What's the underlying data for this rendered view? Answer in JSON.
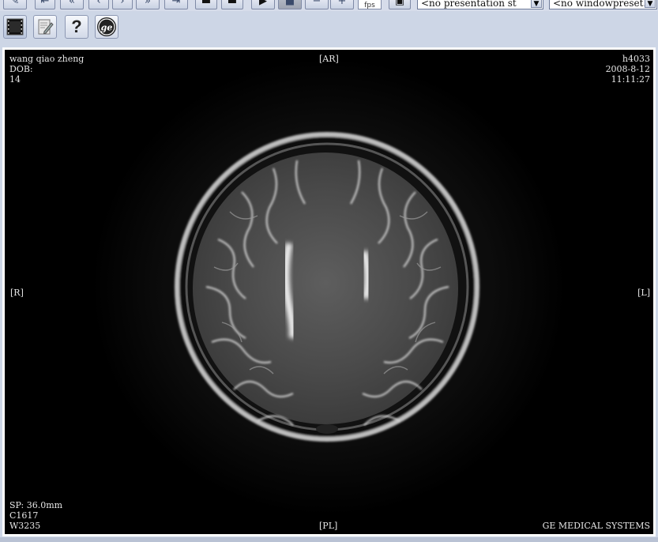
{
  "toolbar_top": {
    "fps_label": "fps",
    "presentation_select": "<no presentation st",
    "window_preset_select": "<no windowpreset."
  },
  "toolbar_second": {
    "tools": [
      {
        "icon": "image-viewer-icon"
      },
      {
        "icon": "edit-note-icon"
      },
      {
        "icon": "help-icon"
      },
      {
        "icon": "ge-logo-icon"
      }
    ],
    "help_glyph": "?"
  },
  "overlay": {
    "patient_name": "wang qiao zheng",
    "dob_label": "DOB:",
    "age": "14",
    "orientation_top": "[AR]",
    "orientation_bottom": "[PL]",
    "orientation_left": "[R]",
    "orientation_right": "[L]",
    "study_id": "h4033",
    "date": "2008-8-12",
    "time": "11:11:27",
    "slice_position": "SP: 36.0mm",
    "window_center": "C1617",
    "window_width": "W3235",
    "manufacturer": "GE MEDICAL SYSTEMS"
  }
}
